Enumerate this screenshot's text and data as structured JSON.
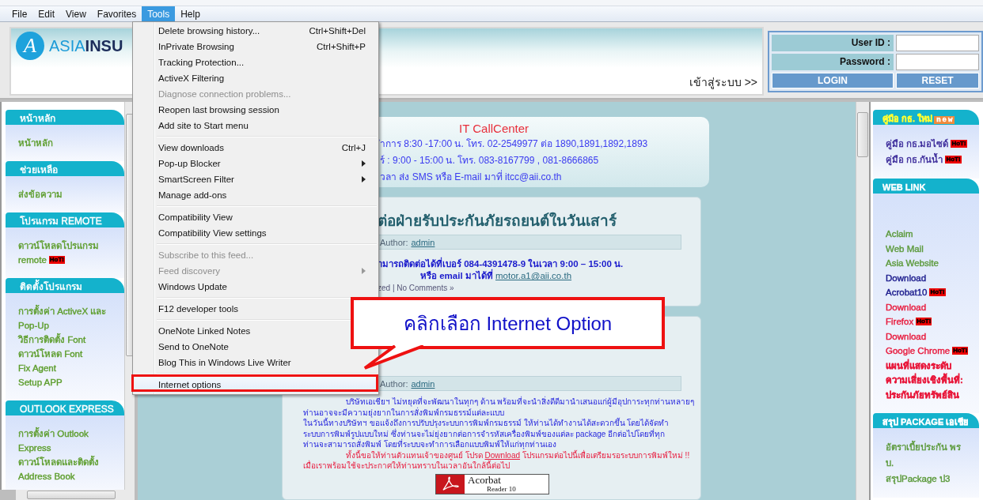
{
  "menubar": [
    {
      "label": "File",
      "selected": false
    },
    {
      "label": "Edit",
      "selected": false
    },
    {
      "label": "View",
      "selected": false
    },
    {
      "label": "Favorites",
      "selected": false
    },
    {
      "label": "Tools",
      "selected": true
    },
    {
      "label": "Help",
      "selected": false
    }
  ],
  "header": {
    "logo": {
      "mark": "A",
      "name": "ASIA**INSU**"
    },
    "login_link": "เข้าสู่ระบบ >>",
    "login": {
      "fields": [
        {
          "label": "User ID :"
        },
        {
          "label": "Password :"
        }
      ],
      "buttons": [
        "LOGIN",
        "RESET"
      ]
    }
  },
  "left_sidebar": {
    "sections": [
      {
        "title": "หน้าหลัก",
        "items": [
          {
            "text": "หน้าหลัก"
          }
        ]
      },
      {
        "title": "ช่วยเหลือ",
        "items": [
          {
            "text": "ส่งข้อความ"
          }
        ]
      },
      {
        "title": "โปรแกรม REMOTE",
        "items": [
          {
            "text": "ดาวน์โหลดโปรแกรม"
          },
          {
            "text": "remote",
            "hot": "HoT!"
          }
        ]
      },
      {
        "title": "ติดตั้งโปรแกรม",
        "items": [
          {
            "text": "การตั้งค่า ActiveX และ"
          },
          {
            "text": "Pop-Up"
          },
          {
            "text": "วิธีการติดตั้ง Font"
          },
          {
            "text": "ดาวน์โหลด Font"
          },
          {
            "text": "Fix Agent"
          },
          {
            "text": "Setup APP"
          }
        ]
      },
      {
        "title": "OUTLOOK EXPRESS",
        "items": [
          {
            "text": "การตั้งค่า Outlook"
          },
          {
            "text": "Express"
          },
          {
            "text": "ดาวน์โหลดและติดตั้ง"
          },
          {
            "text": "Address Book"
          }
        ]
      }
    ]
  },
  "center": {
    "callcenter": {
      "title": "IT CallCenter",
      "lines": [
        "ำการ 8:30 -17:00 น. โทร. 02-2549977 ต่อ 1890,1891,1892,1893",
        "ร์ : 9:00 - 15:00 น. โทร. 083-8167799 , 081-8666865",
        "วลา ส่ง SMS หรือ E-mail มาที่ itcc@aii.co.th"
      ]
    },
    "posts": [
      {
        "title": "ต่อฝ่ายรับประกันภัยรถยนต์ในวันเสาร์",
        "author_label": "Author:",
        "author": "admin",
        "paragraphs": [
          {
            "kind": "contact",
            "lines": [
              {
                "text": "ามารถติดต่อได้ที่เบอร์ 084-4391478-9 ในเวลา 9:00 – 15:00 น."
              },
              {
                "text": "หรือ email มาได้ที่ ",
                "link": "motor.a1@aii.co.th"
              }
            ]
          }
        ],
        "footer": "zed | No Comments »"
      },
      {
        "author_label": "Author:",
        "author": "admin",
        "paragraphs": [
          {
            "kind": "info",
            "lines": [
              {
                "text": "บริษัทเอเชียฯ ไม่หยุดที่จะพัฒนาในทุกๆ ด้าน พร้อมที่จะนำสิ่งดีดีมานำเสนอแก่ผู้มีอุปการะทุกท่านหลายๆ"
              },
              {
                "text": "ท่านอาจจะมีความยุ่งยากในการสั่งพิมพ์กรมธรรม์แต่ละแบบ"
              },
              {
                "text": "ในวันนี้ทางบริษัทฯ ขอแจ้งถึงการปรับปรุงระบบการพิมพ์กรมธรรม์ ให้ท่านได้ทำงานได้สะดวกขึ้น โดยได้จัดทำ"
              },
              {
                "text": "ระบบการพิมพ์รูปแบบใหม่ ซึ่งท่านจะไม่ยุ่งยากต่อการจำรหัสเครื่องพิมพ์ของแต่ละ package อีกต่อไปโดยที่ทุก"
              },
              {
                "text": "ท่านจะสามารถสั่งพิมพ์ โดยที่ระบบจะทำการเลือกแบบพิมพ์ให้แก่ทุกท่านเอง"
              }
            ]
          },
          {
            "kind": "alert",
            "lines": [
              {
                "text": "ทั้งนี้ขอให้ท่านตัวแทนเจ้าของศูนย์ โปรด ",
                "link": "Download",
                "after": " โปรแกรมต่อไปนี้เพื่อเตรียมรอระบบการพิมพ์ใหม่ !!"
              },
              {
                "text": "เมื่อเราพร้อมใช้จะประกาศให้ท่านทราบในเวลาอันใกล้นี้ต่อไป"
              }
            ]
          }
        ],
        "banner": {
          "title": "Acorbat",
          "subtitle": "Reader 10"
        }
      }
    ]
  },
  "right_sidebar": {
    "sections": [
      {
        "title": "คู่มือ กธ. ใหม่",
        "color": "#ffff33",
        "badge": "new",
        "items": [
          {
            "text": "คู่มือ กธ.มอไซด์",
            "hot": "HoT!",
            "kind": "plain",
            "color": "#3b2a9a"
          },
          {
            "text": "คู่มือ กธ.กันน้ำ",
            "hot": "HoT!",
            "kind": "plain",
            "color": "#3b2a9a"
          }
        ]
      },
      {
        "title": "WEB LINK",
        "color": "#ffffff",
        "items": [
          {
            "text": "Aclaim",
            "kind": "plain",
            "color": "#5c9a3c"
          },
          {
            "text": "Web Mail",
            "kind": "plain",
            "color": "#5c9a3c"
          },
          {
            "text": "Asia Website",
            "kind": "plain",
            "color": "#5c9a3c"
          },
          {
            "text": "Download",
            "kind": "plain",
            "color": "#1a1a8c"
          },
          {
            "text": "Acrobat10",
            "hot": "HoT!",
            "kind": "plain",
            "color": "#1a1a8c"
          },
          {
            "text": "Download",
            "kind": "plain",
            "color": "#e8193c"
          },
          {
            "text": "Firefox",
            "hot": "HoT!",
            "kind": "plain",
            "color": "#e8193c"
          },
          {
            "text": "Download",
            "kind": "plain",
            "color": "#e8193c"
          },
          {
            "text": "Google Chrome",
            "hot": "HoT!",
            "kind": "plain",
            "color": "#e8193c"
          },
          {
            "text": "แผนที่แสดงระดับ",
            "kind": "strong",
            "color": "#e8193c"
          },
          {
            "text": "ความเสี่ยงเชิงพื้นที่:",
            "kind": "strong",
            "color": "#e8193c"
          },
          {
            "text": "ประกันภัยทรัพย์สิน",
            "kind": "strong",
            "color": "#e8193c"
          }
        ]
      },
      {
        "title": "สรุป PACKAGE เอเชีย",
        "color": "#ffffff",
        "items": [
          {
            "text": "อัตราเบี้ยประกัน  พร",
            "kind": "plain",
            "color": "#5c9a3c"
          },
          {
            "text": "บ.",
            "kind": "plain",
            "color": "#5c9a3c"
          },
          {
            "text": "สรุปPackage ป3",
            "kind": "plain",
            "color": "#5c9a3c"
          }
        ]
      }
    ]
  },
  "tools_menu": {
    "groups": [
      {
        "items": [
          {
            "label": "Delete browsing history...",
            "shortcut": "Ctrl+Shift+Del",
            "submenu": false,
            "disabled": false,
            "selected": false
          },
          {
            "label": "InPrivate Browsing",
            "shortcut": "Ctrl+Shift+P",
            "submenu": false,
            "disabled": false,
            "selected": false
          },
          {
            "label": "Tracking Protection...",
            "submenu": false,
            "disabled": false,
            "selected": false
          },
          {
            "label": "ActiveX Filtering",
            "submenu": false,
            "disabled": false,
            "selected": false
          },
          {
            "label": "Diagnose connection problems...",
            "submenu": false,
            "disabled": true,
            "selected": false
          },
          {
            "label": "Reopen last browsing session",
            "submenu": false,
            "disabled": false,
            "selected": false
          },
          {
            "label": "Add site to Start menu",
            "submenu": false,
            "disabled": false,
            "selected": false
          }
        ]
      },
      {
        "items": [
          {
            "label": "View downloads",
            "shortcut": "Ctrl+J",
            "submenu": false,
            "disabled": false,
            "selected": false
          },
          {
            "label": "Pop-up Blocker",
            "submenu": true,
            "disabled": false,
            "selected": false
          },
          {
            "label": "SmartScreen Filter",
            "submenu": true,
            "disabled": false,
            "selected": false
          },
          {
            "label": "Manage add-ons",
            "submenu": false,
            "disabled": false,
            "selected": false
          }
        ]
      },
      {
        "items": [
          {
            "label": "Compatibility View",
            "submenu": false,
            "disabled": false,
            "selected": false
          },
          {
            "label": "Compatibility View settings",
            "submenu": false,
            "disabled": false,
            "selected": false
          }
        ]
      },
      {
        "items": [
          {
            "label": "Subscribe to this feed...",
            "submenu": false,
            "disabled": true,
            "selected": false
          },
          {
            "label": "Feed discovery",
            "submenu": true,
            "disabled": true,
            "selected": false
          },
          {
            "label": "Windows Update",
            "submenu": false,
            "disabled": false,
            "selected": false
          }
        ]
      },
      {
        "items": [
          {
            "label": "F12 developer tools",
            "submenu": false,
            "disabled": false,
            "selected": false
          }
        ]
      },
      {
        "items": [
          {
            "label": "OneNote Linked Notes",
            "submenu": false,
            "disabled": false,
            "selected": false
          },
          {
            "label": "Send to OneNote",
            "submenu": false,
            "disabled": false,
            "selected": false
          },
          {
            "label": "Blog This in Windows Live Writer",
            "submenu": false,
            "disabled": false,
            "selected": false
          }
        ]
      },
      {
        "items": [
          {
            "label": "Internet options",
            "submenu": false,
            "disabled": false,
            "selected": true
          }
        ]
      }
    ]
  },
  "callout": {
    "text": "คลิกเลือก Internet Option"
  }
}
